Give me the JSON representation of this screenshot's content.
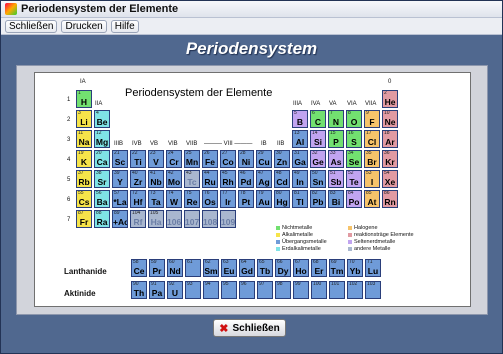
{
  "window": {
    "title": "Periodensystem der Elemente"
  },
  "menu": [
    "Schließen",
    "Drucken",
    "Hilfe"
  ],
  "header": {
    "title": "Periodensystem"
  },
  "table": {
    "title": "Periodensystem der Elemente",
    "lanthanide_label": "Lanthanide",
    "actinide_label": "Aktinide",
    "group_labels": {
      "g1": "IA",
      "g2": "IIA",
      "g3": "IIIB",
      "g4": "IVB",
      "g5": "VB",
      "g6": "VIB",
      "g7": "VIIB",
      "g8": "——— VIII ———",
      "g11": "IB",
      "g12": "IIB",
      "g13": "IIIA",
      "g14": "IVA",
      "g15": "VA",
      "g16": "VIA",
      "g17": "VIIA",
      "g18": "0"
    },
    "colors": {
      "alkali": "#f6e44a",
      "earth": "#7fe3e6",
      "metal": "#6f9bd8",
      "nonmetal": "#72e070",
      "halogen": "#f6c36a",
      "noble": "#e19aa2",
      "semimetal": "#c1a4f0",
      "inactive": "#a9b7cf"
    },
    "elements": [
      {
        "n": 1,
        "s": "H",
        "r": 1,
        "c": 1,
        "t": "nonmetal"
      },
      {
        "n": 2,
        "s": "He",
        "r": 1,
        "c": 18,
        "t": "noble"
      },
      {
        "n": 3,
        "s": "Li",
        "r": 2,
        "c": 1,
        "t": "alkali"
      },
      {
        "n": 4,
        "s": "Be",
        "r": 2,
        "c": 2,
        "t": "earth"
      },
      {
        "n": 5,
        "s": "B",
        "r": 2,
        "c": 13,
        "t": "semimetal"
      },
      {
        "n": 6,
        "s": "C",
        "r": 2,
        "c": 14,
        "t": "nonmetal"
      },
      {
        "n": 7,
        "s": "N",
        "r": 2,
        "c": 15,
        "t": "nonmetal"
      },
      {
        "n": 8,
        "s": "O",
        "r": 2,
        "c": 16,
        "t": "nonmetal"
      },
      {
        "n": 9,
        "s": "F",
        "r": 2,
        "c": 17,
        "t": "halogen"
      },
      {
        "n": 10,
        "s": "Ne",
        "r": 2,
        "c": 18,
        "t": "noble"
      },
      {
        "n": 11,
        "s": "Na",
        "r": 3,
        "c": 1,
        "t": "alkali"
      },
      {
        "n": 12,
        "s": "Mg",
        "r": 3,
        "c": 2,
        "t": "earth"
      },
      {
        "n": 13,
        "s": "Al",
        "r": 3,
        "c": 13,
        "t": "metal"
      },
      {
        "n": 14,
        "s": "Si",
        "r": 3,
        "c": 14,
        "t": "semimetal"
      },
      {
        "n": 15,
        "s": "P",
        "r": 3,
        "c": 15,
        "t": "nonmetal"
      },
      {
        "n": 16,
        "s": "S",
        "r": 3,
        "c": 16,
        "t": "nonmetal"
      },
      {
        "n": 17,
        "s": "Cl",
        "r": 3,
        "c": 17,
        "t": "halogen"
      },
      {
        "n": 18,
        "s": "Ar",
        "r": 3,
        "c": 18,
        "t": "noble"
      },
      {
        "n": 19,
        "s": "K",
        "r": 4,
        "c": 1,
        "t": "alkali"
      },
      {
        "n": 20,
        "s": "Ca",
        "r": 4,
        "c": 2,
        "t": "earth"
      },
      {
        "n": 21,
        "s": "Sc",
        "r": 4,
        "c": 3,
        "t": "metal"
      },
      {
        "n": 22,
        "s": "Ti",
        "r": 4,
        "c": 4,
        "t": "metal"
      },
      {
        "n": 23,
        "s": "V",
        "r": 4,
        "c": 5,
        "t": "metal"
      },
      {
        "n": 24,
        "s": "Cr",
        "r": 4,
        "c": 6,
        "t": "metal"
      },
      {
        "n": 25,
        "s": "Mn",
        "r": 4,
        "c": 7,
        "t": "metal"
      },
      {
        "n": 26,
        "s": "Fe",
        "r": 4,
        "c": 8,
        "t": "metal"
      },
      {
        "n": 27,
        "s": "Co",
        "r": 4,
        "c": 9,
        "t": "metal"
      },
      {
        "n": 28,
        "s": "Ni",
        "r": 4,
        "c": 10,
        "t": "metal"
      },
      {
        "n": 29,
        "s": "Cu",
        "r": 4,
        "c": 11,
        "t": "metal"
      },
      {
        "n": 30,
        "s": "Zn",
        "r": 4,
        "c": 12,
        "t": "metal"
      },
      {
        "n": 31,
        "s": "Ga",
        "r": 4,
        "c": 13,
        "t": "metal"
      },
      {
        "n": 32,
        "s": "Ge",
        "r": 4,
        "c": 14,
        "t": "semimetal"
      },
      {
        "n": 33,
        "s": "As",
        "r": 4,
        "c": 15,
        "t": "semimetal"
      },
      {
        "n": 34,
        "s": "Se",
        "r": 4,
        "c": 16,
        "t": "nonmetal"
      },
      {
        "n": 35,
        "s": "Br",
        "r": 4,
        "c": 17,
        "t": "halogen"
      },
      {
        "n": 36,
        "s": "Kr",
        "r": 4,
        "c": 18,
        "t": "noble"
      },
      {
        "n": 37,
        "s": "Rb",
        "r": 5,
        "c": 1,
        "t": "alkali"
      },
      {
        "n": 38,
        "s": "Sr",
        "r": 5,
        "c": 2,
        "t": "earth"
      },
      {
        "n": 39,
        "s": "Y",
        "r": 5,
        "c": 3,
        "t": "metal"
      },
      {
        "n": 40,
        "s": "Zr",
        "r": 5,
        "c": 4,
        "t": "metal"
      },
      {
        "n": 41,
        "s": "Nb",
        "r": 5,
        "c": 5,
        "t": "metal"
      },
      {
        "n": 42,
        "s": "Mo",
        "r": 5,
        "c": 6,
        "t": "metal"
      },
      {
        "n": 43,
        "s": "Tc",
        "r": 5,
        "c": 7,
        "t": "inactive"
      },
      {
        "n": 44,
        "s": "Ru",
        "r": 5,
        "c": 8,
        "t": "metal"
      },
      {
        "n": 45,
        "s": "Rh",
        "r": 5,
        "c": 9,
        "t": "metal"
      },
      {
        "n": 46,
        "s": "Pd",
        "r": 5,
        "c": 10,
        "t": "metal"
      },
      {
        "n": 47,
        "s": "Ag",
        "r": 5,
        "c": 11,
        "t": "metal"
      },
      {
        "n": 48,
        "s": "Cd",
        "r": 5,
        "c": 12,
        "t": "metal"
      },
      {
        "n": 49,
        "s": "In",
        "r": 5,
        "c": 13,
        "t": "metal"
      },
      {
        "n": 50,
        "s": "Sn",
        "r": 5,
        "c": 14,
        "t": "metal"
      },
      {
        "n": 51,
        "s": "Sb",
        "r": 5,
        "c": 15,
        "t": "semimetal"
      },
      {
        "n": 52,
        "s": "Te",
        "r": 5,
        "c": 16,
        "t": "semimetal"
      },
      {
        "n": 53,
        "s": "I",
        "r": 5,
        "c": 17,
        "t": "halogen"
      },
      {
        "n": 54,
        "s": "Xe",
        "r": 5,
        "c": 18,
        "t": "noble"
      },
      {
        "n": 55,
        "s": "Cs",
        "r": 6,
        "c": 1,
        "t": "alkali"
      },
      {
        "n": 56,
        "s": "Ba",
        "r": 6,
        "c": 2,
        "t": "earth"
      },
      {
        "n": 57,
        "s": "*La",
        "r": 6,
        "c": 3,
        "t": "metal"
      },
      {
        "n": 72,
        "s": "Hf",
        "r": 6,
        "c": 4,
        "t": "metal"
      },
      {
        "n": 73,
        "s": "Ta",
        "r": 6,
        "c": 5,
        "t": "metal"
      },
      {
        "n": 74,
        "s": "W",
        "r": 6,
        "c": 6,
        "t": "metal"
      },
      {
        "n": 75,
        "s": "Re",
        "r": 6,
        "c": 7,
        "t": "metal"
      },
      {
        "n": 76,
        "s": "Os",
        "r": 6,
        "c": 8,
        "t": "metal"
      },
      {
        "n": 77,
        "s": "Ir",
        "r": 6,
        "c": 9,
        "t": "metal"
      },
      {
        "n": 78,
        "s": "Pt",
        "r": 6,
        "c": 10,
        "t": "metal"
      },
      {
        "n": 79,
        "s": "Au",
        "r": 6,
        "c": 11,
        "t": "metal"
      },
      {
        "n": 80,
        "s": "Hg",
        "r": 6,
        "c": 12,
        "t": "metal"
      },
      {
        "n": 81,
        "s": "Tl",
        "r": 6,
        "c": 13,
        "t": "metal"
      },
      {
        "n": 82,
        "s": "Pb",
        "r": 6,
        "c": 14,
        "t": "metal"
      },
      {
        "n": 83,
        "s": "Bi",
        "r": 6,
        "c": 15,
        "t": "metal"
      },
      {
        "n": 84,
        "s": "Po",
        "r": 6,
        "c": 16,
        "t": "semimetal"
      },
      {
        "n": 85,
        "s": "At",
        "r": 6,
        "c": 17,
        "t": "halogen"
      },
      {
        "n": 86,
        "s": "Rn",
        "r": 6,
        "c": 18,
        "t": "noble"
      },
      {
        "n": 87,
        "s": "Fr",
        "r": 7,
        "c": 1,
        "t": "alkali"
      },
      {
        "n": 88,
        "s": "Ra",
        "r": 7,
        "c": 2,
        "t": "earth"
      },
      {
        "n": 89,
        "s": "+Ac",
        "r": 7,
        "c": 3,
        "t": "metal"
      },
      {
        "n": 104,
        "s": "Rf",
        "r": 7,
        "c": 4,
        "t": "inactive"
      },
      {
        "n": 105,
        "s": "Ha",
        "r": 7,
        "c": 5,
        "t": "inactive"
      },
      {
        "n": "",
        "s": "106",
        "r": 7,
        "c": 6,
        "t": "inactive"
      },
      {
        "n": "",
        "s": "107",
        "r": 7,
        "c": 7,
        "t": "inactive"
      },
      {
        "n": "",
        "s": "108",
        "r": 7,
        "c": 8,
        "t": "inactive"
      },
      {
        "n": "",
        "s": "109",
        "r": 7,
        "c": 9,
        "t": "inactive"
      }
    ],
    "lanthanides": [
      {
        "n": 58,
        "s": "Ce"
      },
      {
        "n": 59,
        "s": "Pr"
      },
      {
        "n": 60,
        "s": "Nd"
      },
      {
        "n": 61,
        "s": ""
      },
      {
        "n": 62,
        "s": "Sm"
      },
      {
        "n": 63,
        "s": "Eu"
      },
      {
        "n": 64,
        "s": "Gd"
      },
      {
        "n": 65,
        "s": "Tb"
      },
      {
        "n": 66,
        "s": "Dy"
      },
      {
        "n": 67,
        "s": "Ho"
      },
      {
        "n": 68,
        "s": "Er"
      },
      {
        "n": 69,
        "s": "Tm"
      },
      {
        "n": 70,
        "s": "Yb"
      },
      {
        "n": 71,
        "s": "Lu"
      }
    ],
    "actinides": [
      {
        "n": 90,
        "s": "Th"
      },
      {
        "n": 91,
        "s": "Pa"
      },
      {
        "n": 92,
        "s": "U"
      },
      {
        "n": 93,
        "s": ""
      },
      {
        "n": 94,
        "s": ""
      },
      {
        "n": 95,
        "s": ""
      },
      {
        "n": 96,
        "s": ""
      },
      {
        "n": 97,
        "s": ""
      },
      {
        "n": 98,
        "s": ""
      },
      {
        "n": 99,
        "s": ""
      },
      {
        "n": 100,
        "s": ""
      },
      {
        "n": 101,
        "s": ""
      },
      {
        "n": 102,
        "s": ""
      },
      {
        "n": 103,
        "s": ""
      }
    ],
    "legend": [
      {
        "label": "Nichtmetalle",
        "t": "nonmetal"
      },
      {
        "label": "Halogene",
        "t": "halogen"
      },
      {
        "label": "Alkalimetalle",
        "t": "alkali"
      },
      {
        "label": "reaktionsträge Elemente",
        "t": "noble"
      },
      {
        "label": "Übergangsmetalle",
        "t": "metal"
      },
      {
        "label": "Seltenerdmetalle",
        "t": "semimetal"
      },
      {
        "label": "Erdalkalimetalle",
        "t": "earth"
      },
      {
        "label": "andere Metalle",
        "t": "inactive"
      }
    ]
  },
  "button": {
    "close_label": "Schließen",
    "close_icon": "✖"
  }
}
